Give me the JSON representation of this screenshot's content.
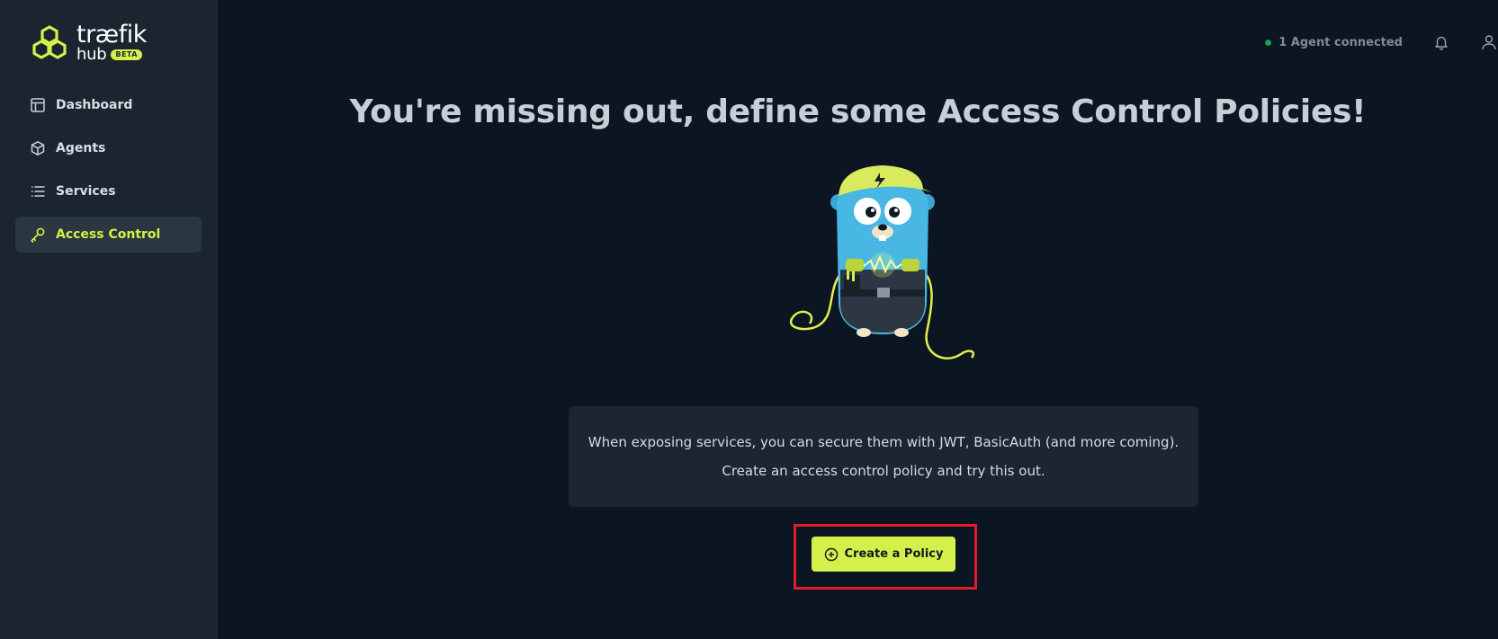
{
  "app": {
    "logo_word": "træfik",
    "logo_sub": "hub",
    "logo_badge": "BETA",
    "accent": "#d5f04a"
  },
  "sidebar": {
    "items": [
      {
        "label": "Dashboard",
        "icon": "layout-icon",
        "active": false
      },
      {
        "label": "Agents",
        "icon": "cube-icon",
        "active": false
      },
      {
        "label": "Services",
        "icon": "list-icon",
        "active": false
      },
      {
        "label": "Access Control",
        "icon": "key-icon",
        "active": true
      }
    ]
  },
  "topbar": {
    "agent_status": "1 Agent connected",
    "status_color": "#1f9c57",
    "notification_icon": "bell-icon",
    "user_icon": "user-icon"
  },
  "main": {
    "headline": "You're missing out, define some Access Control Policies!",
    "mascot": "gopher-electrician-illustration",
    "info_line1": "When exposing services, you can secure them with JWT, BasicAuth (and more coming).",
    "info_line2": "Create an access control policy and try this out.",
    "cta_label": "Create a Policy",
    "cta_icon": "plus-circle-icon",
    "highlight_color": "#e11d2a"
  }
}
